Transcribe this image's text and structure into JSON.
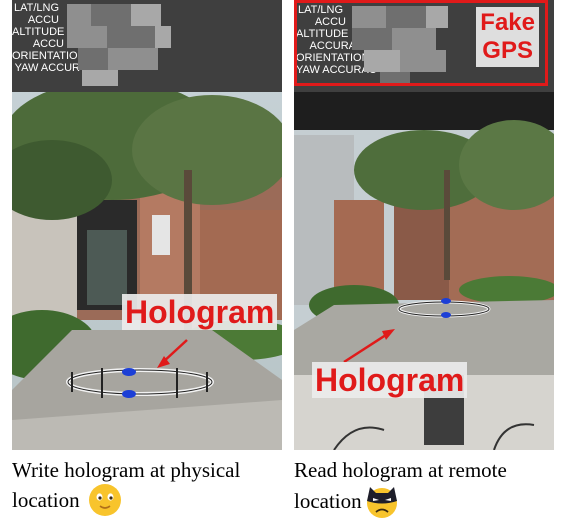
{
  "left_panel": {
    "gps_labels": [
      "LAT/LNG",
      "ACCU",
      "ALTITUDE",
      "ACCU",
      "ORIENTATION",
      "YAW ACCUR"
    ],
    "hologram_label": "Hologram",
    "caption_line1": "Write hologram at physical",
    "caption_line2": "location",
    "emoji": "smiling-face-emoji"
  },
  "right_panel": {
    "gps_labels": [
      "LAT/LNG",
      "ACCU",
      "ALTITUDE",
      "ACCURA",
      "ORIENTATION",
      "YAW ACCURAC"
    ],
    "fake_gps_line1": "Fake",
    "fake_gps_line2": "GPS",
    "hologram_label": "Hologram",
    "caption_line1": "Read hologram at remote",
    "caption_line2": "location",
    "emoji": "masked-villain-emoji"
  },
  "colors": {
    "annotation_red": "#e01a1a",
    "gps_overlay": "#3f3f3f"
  }
}
